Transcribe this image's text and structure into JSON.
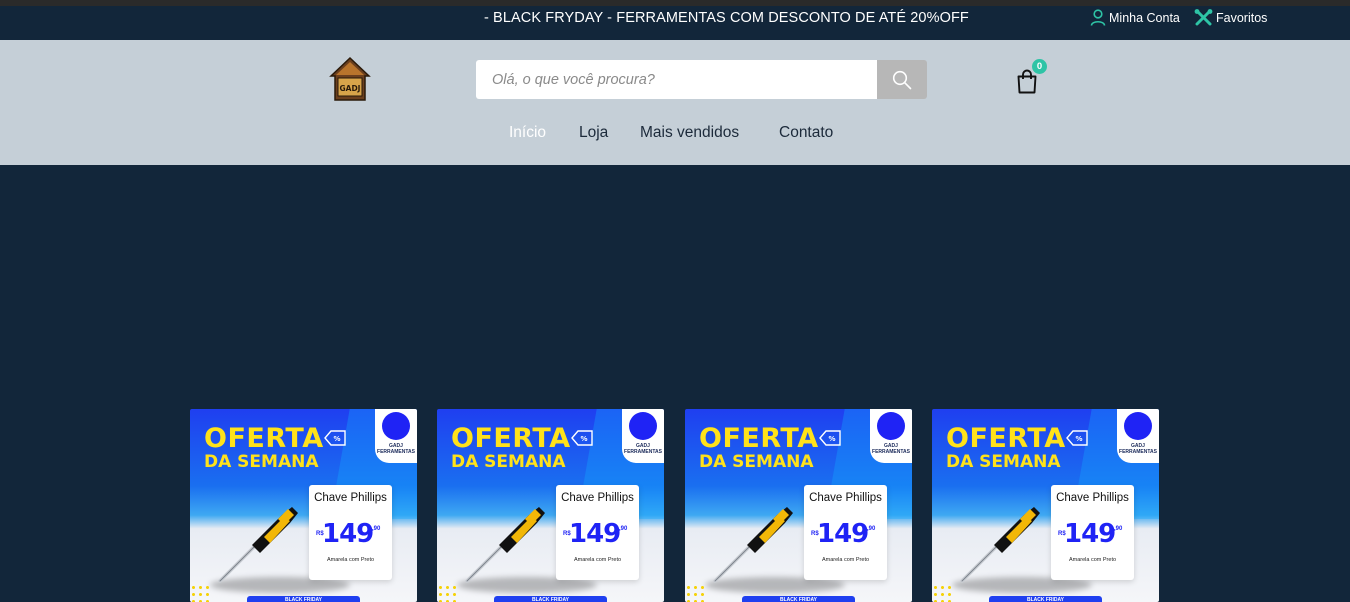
{
  "topbar": {
    "promo": "- BLACK FRYDAY - FERRAMENTAS COM DESCONTO DE ATÉ 20%OFF",
    "account_label": "Minha Conta",
    "favorites_label": "Favoritos",
    "accent_color": "#2ec4a6"
  },
  "header": {
    "logo_text": "GADJ",
    "search": {
      "placeholder": "Olá, o que você procura?",
      "value": ""
    },
    "cart_count": "0"
  },
  "nav": {
    "items": [
      {
        "label": "Início",
        "active": true
      },
      {
        "label": "Loja",
        "active": false
      },
      {
        "label": "Mais vendidos",
        "active": false
      },
      {
        "label": "Contato",
        "active": false
      }
    ]
  },
  "products": [
    {
      "headline": "OFERTA",
      "subheadline": "DA SEMANA",
      "brand": "GADJ FERRAMENTAS",
      "name": "Chave Phillips",
      "currency": "R$",
      "price": "149",
      "cents": ",90",
      "description": "Amarela com Preto",
      "banner": "BLACK FRIDAY"
    },
    {
      "headline": "OFERTA",
      "subheadline": "DA SEMANA",
      "brand": "GADJ FERRAMENTAS",
      "name": "Chave Phillips",
      "currency": "R$",
      "price": "149",
      "cents": ",90",
      "description": "Amarela com Preto",
      "banner": "BLACK FRIDAY"
    },
    {
      "headline": "OFERTA",
      "subheadline": "DA SEMANA",
      "brand": "GADJ FERRAMENTAS",
      "name": "Chave Phillips",
      "currency": "R$",
      "price": "149",
      "cents": ",90",
      "description": "Amarela com Preto",
      "banner": "BLACK FRIDAY"
    },
    {
      "headline": "OFERTA",
      "subheadline": "DA SEMANA",
      "brand": "GADJ FERRAMENTAS",
      "name": "Chave Phillips",
      "currency": "R$",
      "price": "149",
      "cents": ",90",
      "description": "Amarela com Preto",
      "banner": "BLACK FRIDAY"
    }
  ],
  "colors": {
    "page_background": "#12263a",
    "header_background": "#c5cfd7",
    "offer_yellow": "#ffe21a",
    "price_blue": "#1f23f5"
  }
}
